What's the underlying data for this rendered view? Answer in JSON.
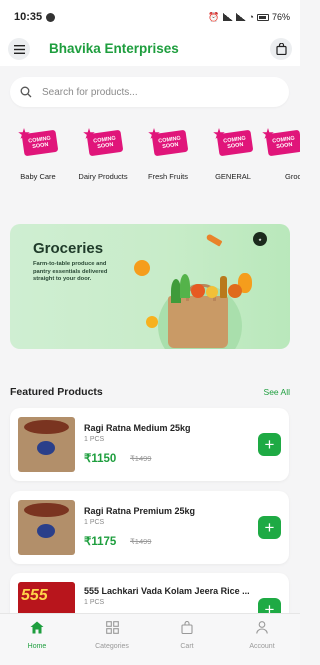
{
  "status_bar": {
    "time": "10:35",
    "battery": "76%"
  },
  "app_bar": {
    "title": "Bhavika Enterprises"
  },
  "search": {
    "placeholder": "Search for products..."
  },
  "categories": [
    {
      "label": "Baby Care",
      "badge": [
        "COMING",
        "SOON"
      ]
    },
    {
      "label": "Dairy Products",
      "badge": [
        "COMING",
        "SOON"
      ]
    },
    {
      "label": "Fresh Fruits",
      "badge": [
        "COMING",
        "SOON"
      ]
    },
    {
      "label": "GENERAL",
      "badge": [
        "COMING",
        "SOON"
      ]
    },
    {
      "label": "Groc",
      "badge": [
        "COMING",
        "SOON"
      ]
    }
  ],
  "banner": {
    "title": "Groceries",
    "description": "Farm-to-table produce and pantry essentials delivered straight to your door."
  },
  "featured": {
    "title": "Featured Products",
    "see_all": "See All",
    "products": [
      {
        "name": "Ragi Ratna Medium 25kg",
        "unit": "1 PCS",
        "price": "₹1150",
        "mrp": "₹1499"
      },
      {
        "name": "Ragi Ratna Premium 25kg",
        "unit": "1 PCS",
        "price": "₹1175",
        "mrp": "₹1499"
      },
      {
        "name": "555 Lachkari Vada Kolam Jeera Rice ...",
        "unit": "1 PCS",
        "price": "",
        "mrp": "",
        "image_text": "555"
      }
    ]
  },
  "bottom_nav": [
    {
      "label": "Home",
      "icon": "home-icon",
      "active": true
    },
    {
      "label": "Categories",
      "icon": "grid-icon",
      "active": false
    },
    {
      "label": "Cart",
      "icon": "bag-icon",
      "active": false
    },
    {
      "label": "Account",
      "icon": "person-icon",
      "active": false
    }
  ],
  "colors": {
    "brand_green": "#1e9e3e",
    "badge_pink": "#e0157a",
    "banner_bg": "#c8ecc9"
  }
}
